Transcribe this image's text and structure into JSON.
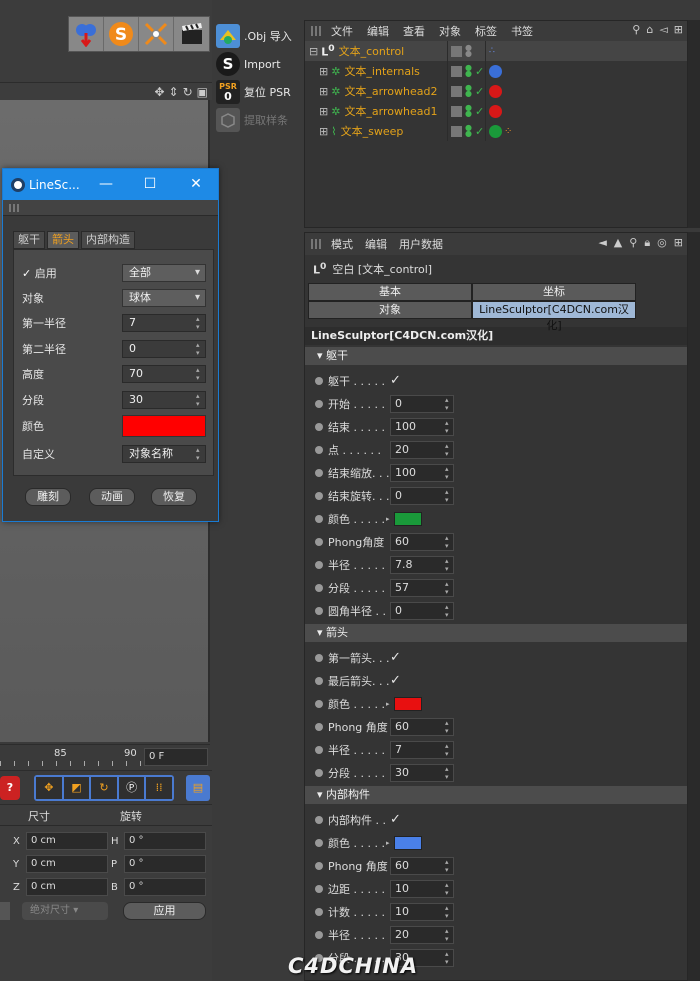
{
  "toolbar": {
    "icons": [
      "cloner-icon",
      "s-plugin-icon",
      "target-icon",
      "clapper-icon"
    ],
    "import": [
      {
        "icon": "obj-import-icon",
        "label": ".Obj 导入"
      },
      {
        "icon": "import-icon",
        "label": "Import"
      },
      {
        "icon": "psr-icon",
        "badge_top": "PSR",
        "badge_bottom": "0",
        "label": "复位 PSR"
      },
      {
        "icon": "extract-icon",
        "label": "提取样条"
      }
    ]
  },
  "object_manager": {
    "menu": [
      "文件",
      "编辑",
      "查看",
      "对象",
      "标签",
      "书签"
    ],
    "objects": [
      {
        "name": "文本_control",
        "material_color": ""
      },
      {
        "name": "文本_internals",
        "material_color": "#3a6fd8"
      },
      {
        "name": "文本_arrowhead2",
        "material_color": "#d81818"
      },
      {
        "name": "文本_arrowhead1",
        "material_color": "#d81818"
      },
      {
        "name": "文本_sweep",
        "material_color": "#1a9a3a"
      }
    ]
  },
  "attribute_manager": {
    "menu": [
      "模式",
      "编辑",
      "用户数据"
    ],
    "title": "空白 [文本_control]",
    "tab_headers": [
      "基本",
      "坐标"
    ],
    "tab_row": [
      "对象",
      "LineSculptor[C4DCN.com汉化]"
    ],
    "section_title": "LineSculptor[C4DCN.com汉化]",
    "groups": [
      {
        "title": "躯干",
        "params": [
          {
            "label": "躯干 . . . . .",
            "type": "check"
          },
          {
            "label": "开始 . . . . .",
            "value": "0"
          },
          {
            "label": "结束 . . . . .",
            "value": "100"
          },
          {
            "label": "点 . . . . . .",
            "value": "20"
          },
          {
            "label": "结束缩放. . .",
            "value": "100"
          },
          {
            "label": "结束旋转. . .",
            "value": "0"
          },
          {
            "label": "颜色 . . . . .",
            "type": "color",
            "color": "#1a9a3a"
          },
          {
            "label": "Phong角度",
            "value": "60"
          },
          {
            "label": "半径 . . . . .",
            "value": "7.8"
          },
          {
            "label": "分段 . . . . .",
            "value": "57"
          },
          {
            "label": "圆角半径 . .",
            "value": "0"
          }
        ]
      },
      {
        "title": "箭头",
        "params": [
          {
            "label": "第一箭头. . .",
            "type": "check"
          },
          {
            "label": "最后箭头. . .",
            "type": "check"
          },
          {
            "label": "颜色 . . . . .",
            "type": "color",
            "color": "#e81010"
          },
          {
            "label": "Phong 角度",
            "value": "60"
          },
          {
            "label": "半径 . . . . .",
            "value": "7"
          },
          {
            "label": "分段 . . . . .",
            "value": "30"
          }
        ]
      },
      {
        "title": "内部构件",
        "params": [
          {
            "label": "内部构件 . . .",
            "type": "check"
          },
          {
            "label": "颜色 . . . . .",
            "type": "color",
            "color": "#4a80e8"
          },
          {
            "label": "Phong 角度",
            "value": "60"
          },
          {
            "label": "边距 . . . . .",
            "value": "10"
          },
          {
            "label": "计数 . . . . .",
            "value": "10"
          },
          {
            "label": "半径 . . . . .",
            "value": "20"
          },
          {
            "label": "分段 . . . . .",
            "value": "30"
          }
        ]
      }
    ]
  },
  "timeline": {
    "ticks": [
      "85",
      "90"
    ],
    "frame": "0 F"
  },
  "coords": {
    "headers": [
      "尺寸",
      "旋转"
    ],
    "rows": [
      {
        "axis": "X",
        "size": "0 cm",
        "rot_axis": "H",
        "rot": "0 °"
      },
      {
        "axis": "Y",
        "size": "0 cm",
        "rot_axis": "P",
        "rot": "0 °"
      },
      {
        "axis": "Z",
        "size": "0 cm",
        "rot_axis": "B",
        "rot": "0 °"
      }
    ],
    "mode": "绝对尺寸",
    "apply": "应用"
  },
  "dialog": {
    "title": "LineSc...",
    "tabs": [
      "躯干",
      "箭头",
      "内部构造"
    ],
    "active_tab": 1,
    "rows": {
      "enable_label": "启用",
      "enable_value": "全部",
      "object_label": "对象",
      "object_value": "球体",
      "r1_label": "第一半径",
      "r1_value": "7",
      "r2_label": "第二半径",
      "r2_value": "0",
      "height_label": "高度",
      "height_value": "70",
      "seg_label": "分段",
      "seg_value": "30",
      "color_label": "颜色",
      "color_value": "#ff0000",
      "custom_label": "自定义",
      "custom_value": "对象名称"
    },
    "buttons": [
      "雕刻",
      "动画",
      "恢复"
    ]
  },
  "watermark": "C4DCHINA"
}
